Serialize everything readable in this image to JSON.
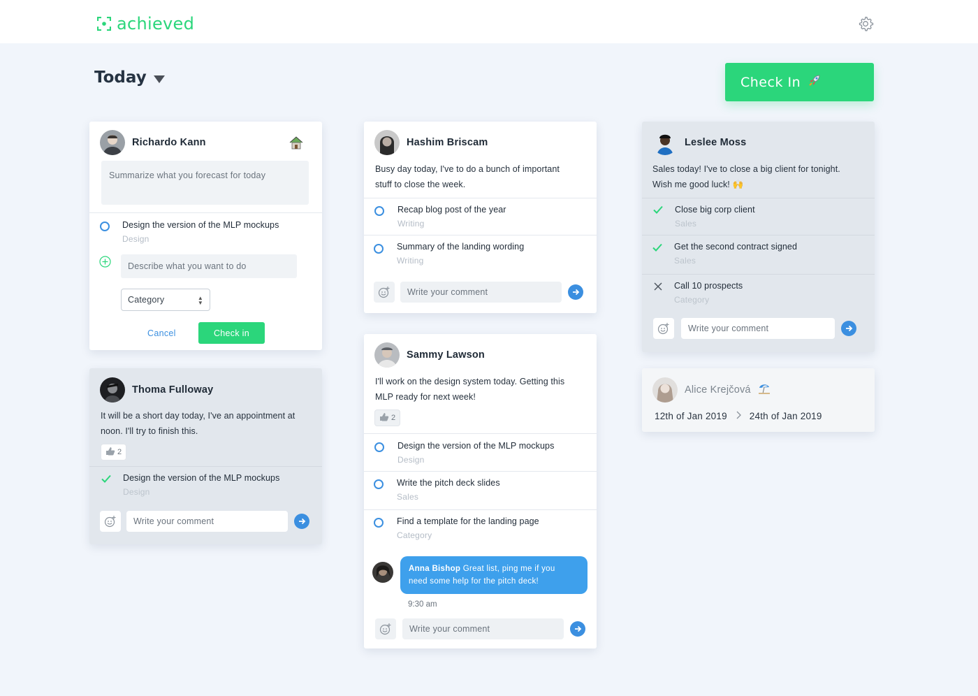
{
  "app": {
    "name": "achieved"
  },
  "header": {
    "title": "Today",
    "checkin_label": "Check In"
  },
  "colors": {
    "accent": "#2bd67b",
    "link": "#3b8fe0"
  },
  "cards": {
    "richardo": {
      "name": "Richardo Kann",
      "forecast_placeholder": "Summarize what you forecast for today",
      "task": {
        "title": "Design the version of the MLP mockups",
        "category": "Design"
      },
      "describe_placeholder": "Describe what you want to do",
      "category_select": "Category",
      "cancel_label": "Cancel",
      "checkin_label": "Check in"
    },
    "thoma": {
      "name": "Thoma Fulloway",
      "message_line1": "It will be a short day today, I've an appointment at",
      "message_line2": "noon. I'll try to finish this.",
      "likes": "2",
      "task": {
        "title": "Design the version of the MLP mockups",
        "category": "Design"
      },
      "comment_placeholder": "Write your comment"
    },
    "hashim": {
      "name": "Hashim Briscam",
      "message_line1": "Busy day today, I've to do a bunch of important",
      "message_line2": "stuff to close the week.",
      "tasks": [
        {
          "title": "Recap blog post of the year",
          "category": "Writing"
        },
        {
          "title": "Summary of the landing wording",
          "category": "Writing"
        }
      ],
      "comment_placeholder": "Write your comment"
    },
    "sammy": {
      "name": "Sammy Lawson",
      "message_line1": "I'll work on the design system today. Getting this",
      "message_line2": "MLP ready for next week!",
      "likes": "2",
      "tasks": [
        {
          "title": "Design the version of the MLP mockups",
          "category": "Design"
        },
        {
          "title": "Write the pitch deck slides",
          "category": "Sales"
        },
        {
          "title": "Find a template for the landing page",
          "category": "Category"
        }
      ],
      "comment": {
        "author": "Anna Bishop",
        "text_line1": " Great list, ping me if you",
        "text_line2": "need some help for the pitch deck!",
        "time": "9:30 am"
      },
      "comment_placeholder": "Write your comment"
    },
    "leslee": {
      "name": "Leslee Moss",
      "message_line1": "Sales today! I've to close a big client for tonight.",
      "message_line2": "Wish me good luck! 🙌",
      "tasks": [
        {
          "title": "Close big corp client",
          "category": "Sales",
          "status": "done"
        },
        {
          "title": "Get the second contract signed",
          "category": "Sales",
          "status": "done"
        },
        {
          "title": "Call 10 prospects",
          "category": "Category",
          "status": "failed"
        }
      ],
      "comment_placeholder": "Write your comment"
    },
    "alice": {
      "name": "Alice Krejčová",
      "date_from": "12th of Jan 2019",
      "date_to": "24th of Jan 2019"
    }
  }
}
